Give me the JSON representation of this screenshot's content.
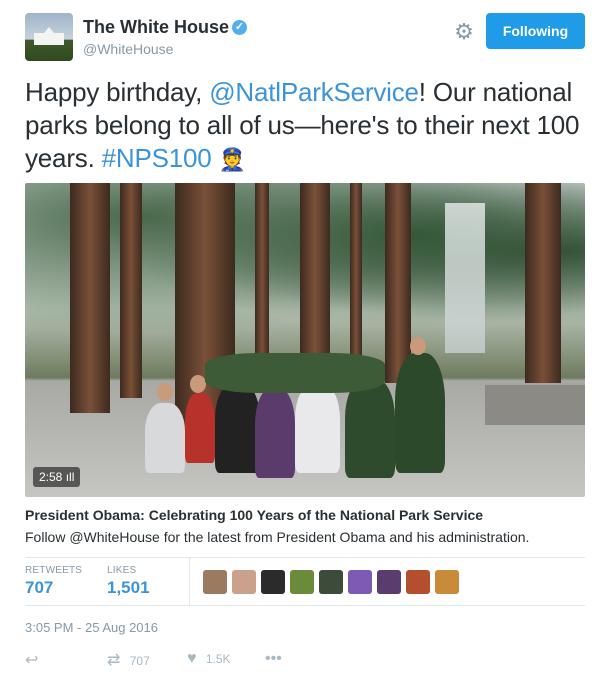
{
  "header": {
    "name": "The White House",
    "verified_mark": "✓",
    "handle": "@WhiteHouse",
    "follow_label": "Following",
    "accent": "#1f9be8"
  },
  "tweet": {
    "text_1": "Happy birthday, ",
    "mention": "@NatlParkService",
    "text_2": "! Our national parks belong to all of us—here's to their next 100 years. ",
    "hashtag": "#NPS100",
    "emoji": "👮"
  },
  "video": {
    "duration": "2:58"
  },
  "card": {
    "title": "President Obama: Celebrating 100 Years of the National Park Service",
    "description": "Follow @WhiteHouse for the latest from President Obama and his administration."
  },
  "stats": {
    "retweets_label": "RETWEETS",
    "retweets_value": "707",
    "likes_label": "LIKES",
    "likes_value": "1,501"
  },
  "timestamp": "3:05 PM - 25 Aug 2016",
  "actions": {
    "retweet_count": "707",
    "like_count": "1.5K"
  },
  "icons": [
    "gear-icon",
    "verified-icon",
    "reply-icon",
    "retweet-icon",
    "heart-icon",
    "more-icon"
  ]
}
